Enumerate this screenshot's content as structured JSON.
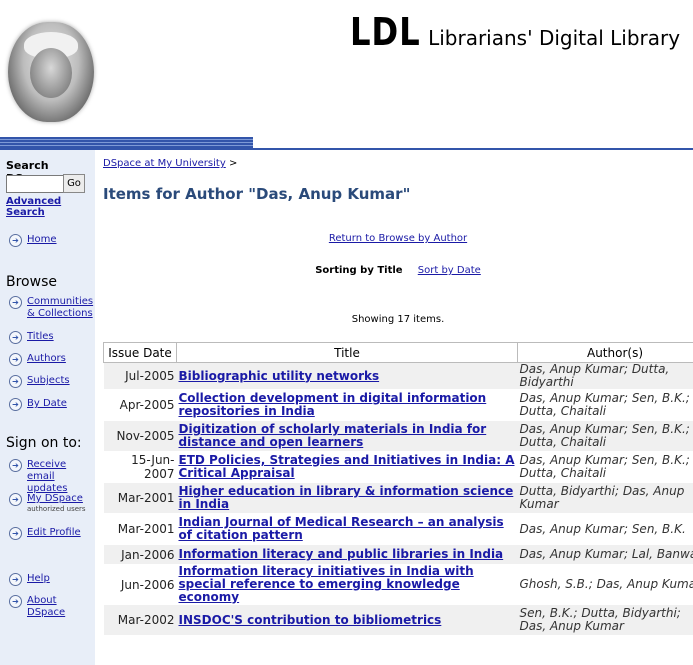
{
  "header": {
    "logo_big": "LDL",
    "logo_small": "Librarians' Digital Library"
  },
  "sidebar": {
    "search_title": "Search DSpace",
    "search_value": "",
    "go_label": "Go",
    "advanced_search": "Advanced Search",
    "home": "Home",
    "browse_heading": "Browse",
    "browse_items": [
      {
        "line1": "Communities",
        "line2": "& Collections"
      },
      {
        "line1": "Titles",
        "line2": ""
      },
      {
        "line1": "Authors",
        "line2": ""
      },
      {
        "line1": "Subjects",
        "line2": ""
      },
      {
        "line1": "By Date",
        "line2": ""
      }
    ],
    "signon_heading": "Sign on to:",
    "receive_email_1": "Receive email",
    "receive_email_2": "updates",
    "my_dspace": "My DSpace",
    "authorized_users": "authorized users",
    "edit_profile": "Edit Profile",
    "help": "Help",
    "about": "About DSpace"
  },
  "main": {
    "breadcrumb_link": "DSpace at My University",
    "breadcrumb_sep": ">",
    "page_title": "Items for Author \"Das, Anup Kumar\"",
    "return_link": "Return to Browse by Author",
    "sorting_label": "Sorting by Title",
    "sort_by_date": "Sort by Date",
    "showing": "Showing 17 items."
  },
  "table": {
    "headers": [
      "Issue Date",
      "Title",
      "Author(s)"
    ],
    "rows": [
      {
        "date": "Jul-2005",
        "title": "Bibliographic utility networks",
        "author1": "Das, Anup Kumar; Dutta,",
        "author2": "Bidyarthi"
      },
      {
        "date": "Apr-2005",
        "title": "Collection development in digital information repositories in India",
        "author1": "Das, Anup Kumar; Sen, B.K.;",
        "author2": "Dutta, Chaitali"
      },
      {
        "date": "Nov-2005",
        "title": "Digitization of scholarly materials in India for distance and open learners",
        "author1": "Das, Anup Kumar; Sen, B.K.;",
        "author2": "Dutta, Chaitali"
      },
      {
        "date": "15-Jun-2007",
        "title": "ETD Policies, Strategies and Initiatives in India: A Critical Appraisal",
        "author1": "Das, Anup Kumar; Sen, B.K.;",
        "author2": "Dutta, Chaitali"
      },
      {
        "date": "Mar-2001",
        "title": "Higher education in library & information science in India",
        "author1": "Dutta, Bidyarthi; Das, Anup",
        "author2": "Kumar"
      },
      {
        "date": "Mar-2001",
        "title": "Indian Journal of Medical Research – an analysis of citation pattern",
        "author1": "Das, Anup Kumar; Sen, B.K.",
        "author2": ""
      },
      {
        "date": "Jan-2006",
        "title": "Information literacy and public libraries in India",
        "author1": "Das, Anup Kumar; Lal, Banwar",
        "author2": ""
      },
      {
        "date": "Jun-2006",
        "title": "Information literacy initiatives in India with special reference to emerging knowledge economy",
        "author1": "Ghosh, S.B.; Das, Anup Kumar",
        "author2": ""
      },
      {
        "date": "Mar-2002",
        "title": "INSDOC'S contribution to bibliometrics",
        "author1": "Sen, B.K.; Dutta, Bidyarthi;",
        "author2": "Das, Anup Kumar"
      }
    ]
  },
  "colors": {
    "accent_blue": "#3355aa",
    "title_color": "#2a4a7a",
    "link_color": "#1a1aa6",
    "sidebar_bg": "#e8eef8"
  }
}
